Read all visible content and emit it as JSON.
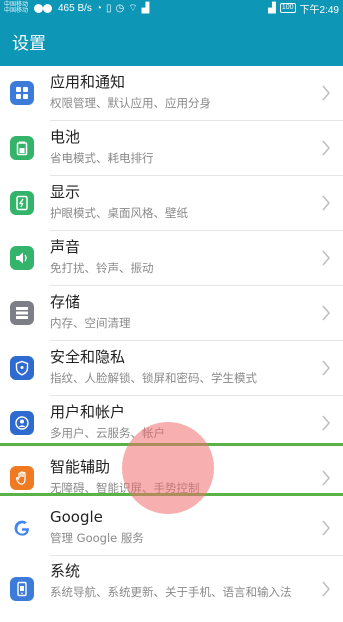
{
  "status_bar": {
    "carrier_lines": [
      "中国移动",
      "中国移动"
    ],
    "speed": "465 B/s",
    "battery": "100",
    "time": "下午2:49"
  },
  "header": {
    "title": "设置"
  },
  "items": [
    {
      "title": "应用和通知",
      "subtitle": "权限管理、默认应用、应用分身",
      "icon": "apps-icon",
      "color": "#3d7bd8"
    },
    {
      "title": "电池",
      "subtitle": "省电模式、耗电排行",
      "icon": "battery-icon",
      "color": "#33b46a"
    },
    {
      "title": "显示",
      "subtitle": "护眼模式、桌面风格、壁纸",
      "icon": "display-icon",
      "color": "#33b46a"
    },
    {
      "title": "声音",
      "subtitle": "免打扰、铃声、振动",
      "icon": "sound-icon",
      "color": "#33b46a"
    },
    {
      "title": "存储",
      "subtitle": "内存、空间清理",
      "icon": "storage-icon",
      "color": "#7c7f86"
    },
    {
      "title": "安全和隐私",
      "subtitle": "指纹、人脸解锁、锁屏和密码、学生模式",
      "icon": "shield-icon",
      "color": "#2f6ad0"
    },
    {
      "title": "用户和帐户",
      "subtitle": "多用户、云服务、帐户",
      "icon": "user-icon",
      "color": "#2f6ad0"
    },
    {
      "title": "智能辅助",
      "subtitle": "无障碍、智能识屏、手势控制",
      "icon": "hand-icon",
      "color": "#f07a22"
    },
    {
      "title": "Google",
      "subtitle": "管理 Google 服务",
      "icon": "google-icon",
      "color": "#3d7bd8"
    },
    {
      "title": "系统",
      "subtitle": "系统导航、系统更新、关于手机、语言和输入法",
      "icon": "phone-icon",
      "color": "#3d7bd8"
    }
  ]
}
